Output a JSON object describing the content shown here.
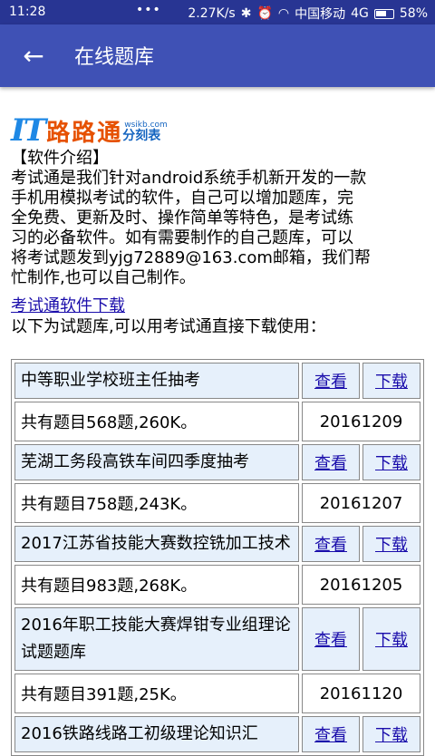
{
  "status": {
    "time": "11:28",
    "speed": "2.27K/s",
    "carrier": "中国移动",
    "network": "4G",
    "battery": "58%"
  },
  "appbar": {
    "title": "在线题库"
  },
  "logo": {
    "mark": "IT",
    "brand": "路路通",
    "url": "wsikb.com",
    "sub": "分刻表"
  },
  "intro": {
    "heading": "【软件介绍】",
    "line1": "考试通是我们针对android系统手机新开发的一款",
    "line2": "手机用模拟考试的软件，自己可以增加题库，完",
    "line3": "全免费、更新及时、操作简单等特色，是考试练",
    "line4": "习的必备软件。如有需要制作的自己题库，可以",
    "line5": "将考试题发到yjg72889@163.com邮箱，我们帮",
    "line6": "忙制作,也可以自己制作。"
  },
  "download_link": "考试通软件下载",
  "list_caption": "以下为试题库,可以用考试通直接下载使用：",
  "actions": {
    "view": "查看",
    "download": "下载"
  },
  "items": [
    {
      "name": "中等职业学校班主任抽考",
      "info": "共有题目568题,260K。",
      "date": "20161209"
    },
    {
      "name": "芜湖工务段高铁车间四季度抽考",
      "info": "共有题目758题,243K。",
      "date": "20161207"
    },
    {
      "name": "2017江苏省技能大赛数控铣加工技术",
      "info": "共有题目983题,268K。",
      "date": "20161205"
    },
    {
      "name": "2016年职工技能大赛焊钳专业组理论试题题库",
      "info": "共有题目391题,25K。",
      "date": "20161120"
    },
    {
      "name": "2016铁路线路工初级理论知识汇",
      "info": "",
      "date": ""
    }
  ]
}
